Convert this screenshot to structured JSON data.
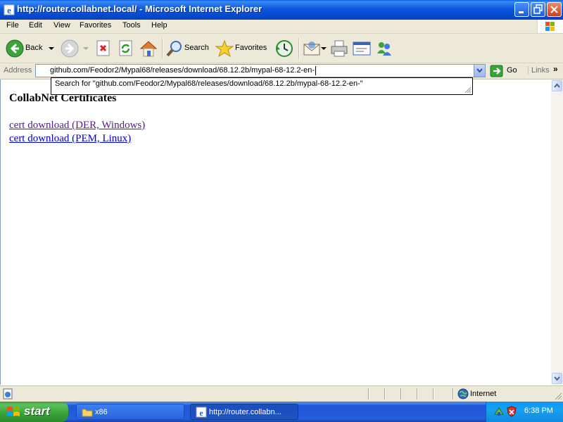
{
  "window": {
    "title": "http://router.collabnet.local/ - Microsoft Internet Explorer"
  },
  "menu": [
    "File",
    "Edit",
    "View",
    "Favorites",
    "Tools",
    "Help"
  ],
  "toolbar": {
    "back_label": "Back",
    "search_label": "Search",
    "favorites_label": "Favorites"
  },
  "address": {
    "label": "Address",
    "value": "github.com/Feodor2/Mypal68/releases/download/68.12.2b/mypal-68-12.2-en-",
    "go_label": "Go",
    "links_label": "Links",
    "links_more": "»"
  },
  "autocomplete": {
    "text": "Search for \"github.com/Feodor2/Mypal68/releases/download/68.12.2b/mypal-68-12.2-en-\""
  },
  "page": {
    "heading": "CollabNet Certificates",
    "links": [
      {
        "label": "cert download (DER, Windows)",
        "visited": true
      },
      {
        "label": "cert download (PEM, Linux)",
        "visited": false
      }
    ]
  },
  "statusbar": {
    "zone": "Internet"
  },
  "taskbar": {
    "start_label": "start",
    "tasks": [
      {
        "label": "x86",
        "icon": "folder-icon",
        "active": false
      },
      {
        "label": "http://router.collabn...",
        "icon": "ie-page-icon",
        "active": true
      }
    ],
    "clock": "6:38 PM"
  },
  "colors": {
    "titlebar": "#0b56dd",
    "chrome": "#ece9d8",
    "visited_link": "#551a8b",
    "link": "#0000cc",
    "start_green": "#37a237",
    "taskbar_blue": "#245edb"
  }
}
